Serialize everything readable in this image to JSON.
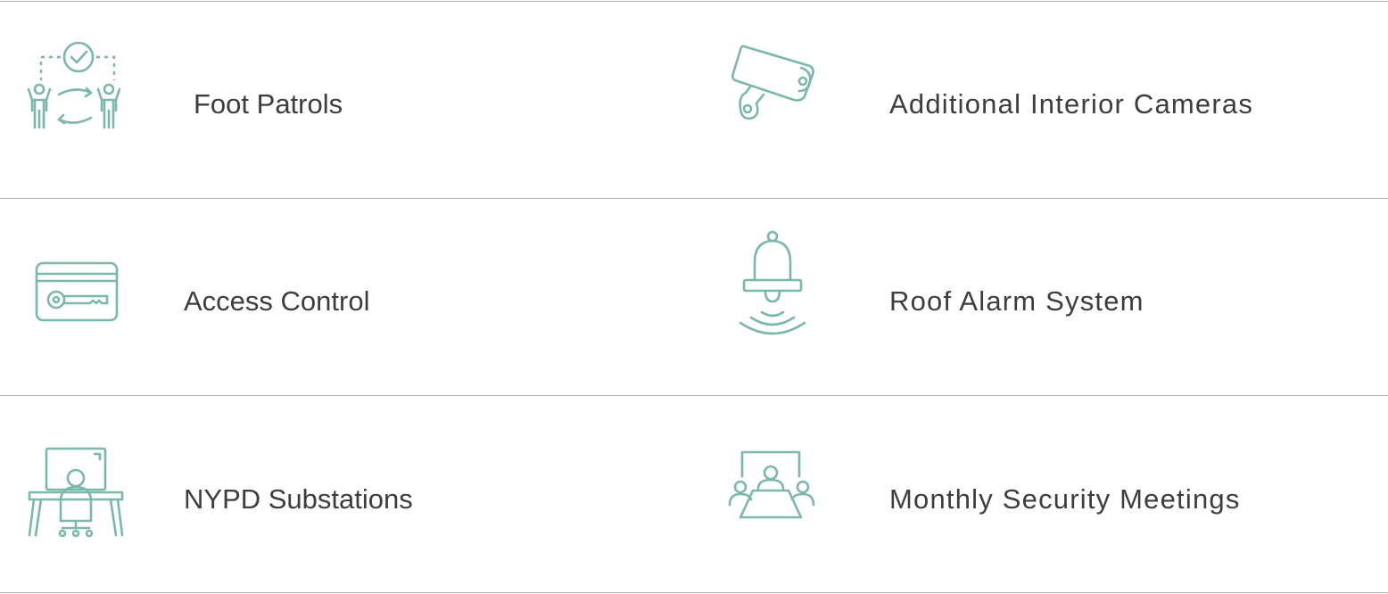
{
  "colors": {
    "icon": "#7ab8ae",
    "text": "#3d3d3d",
    "divider": "#b3b3b3"
  },
  "items": [
    {
      "label": "Foot Patrols",
      "icon": "patrol-icon"
    },
    {
      "label": "Additional Interior Cameras",
      "icon": "security-camera-icon"
    },
    {
      "label": "Access Control",
      "icon": "key-card-icon"
    },
    {
      "label": "Roof Alarm System",
      "icon": "alarm-bell-icon"
    },
    {
      "label": "NYPD Substations",
      "icon": "workstation-icon"
    },
    {
      "label": "Monthly Security Meetings",
      "icon": "meeting-icon"
    }
  ]
}
